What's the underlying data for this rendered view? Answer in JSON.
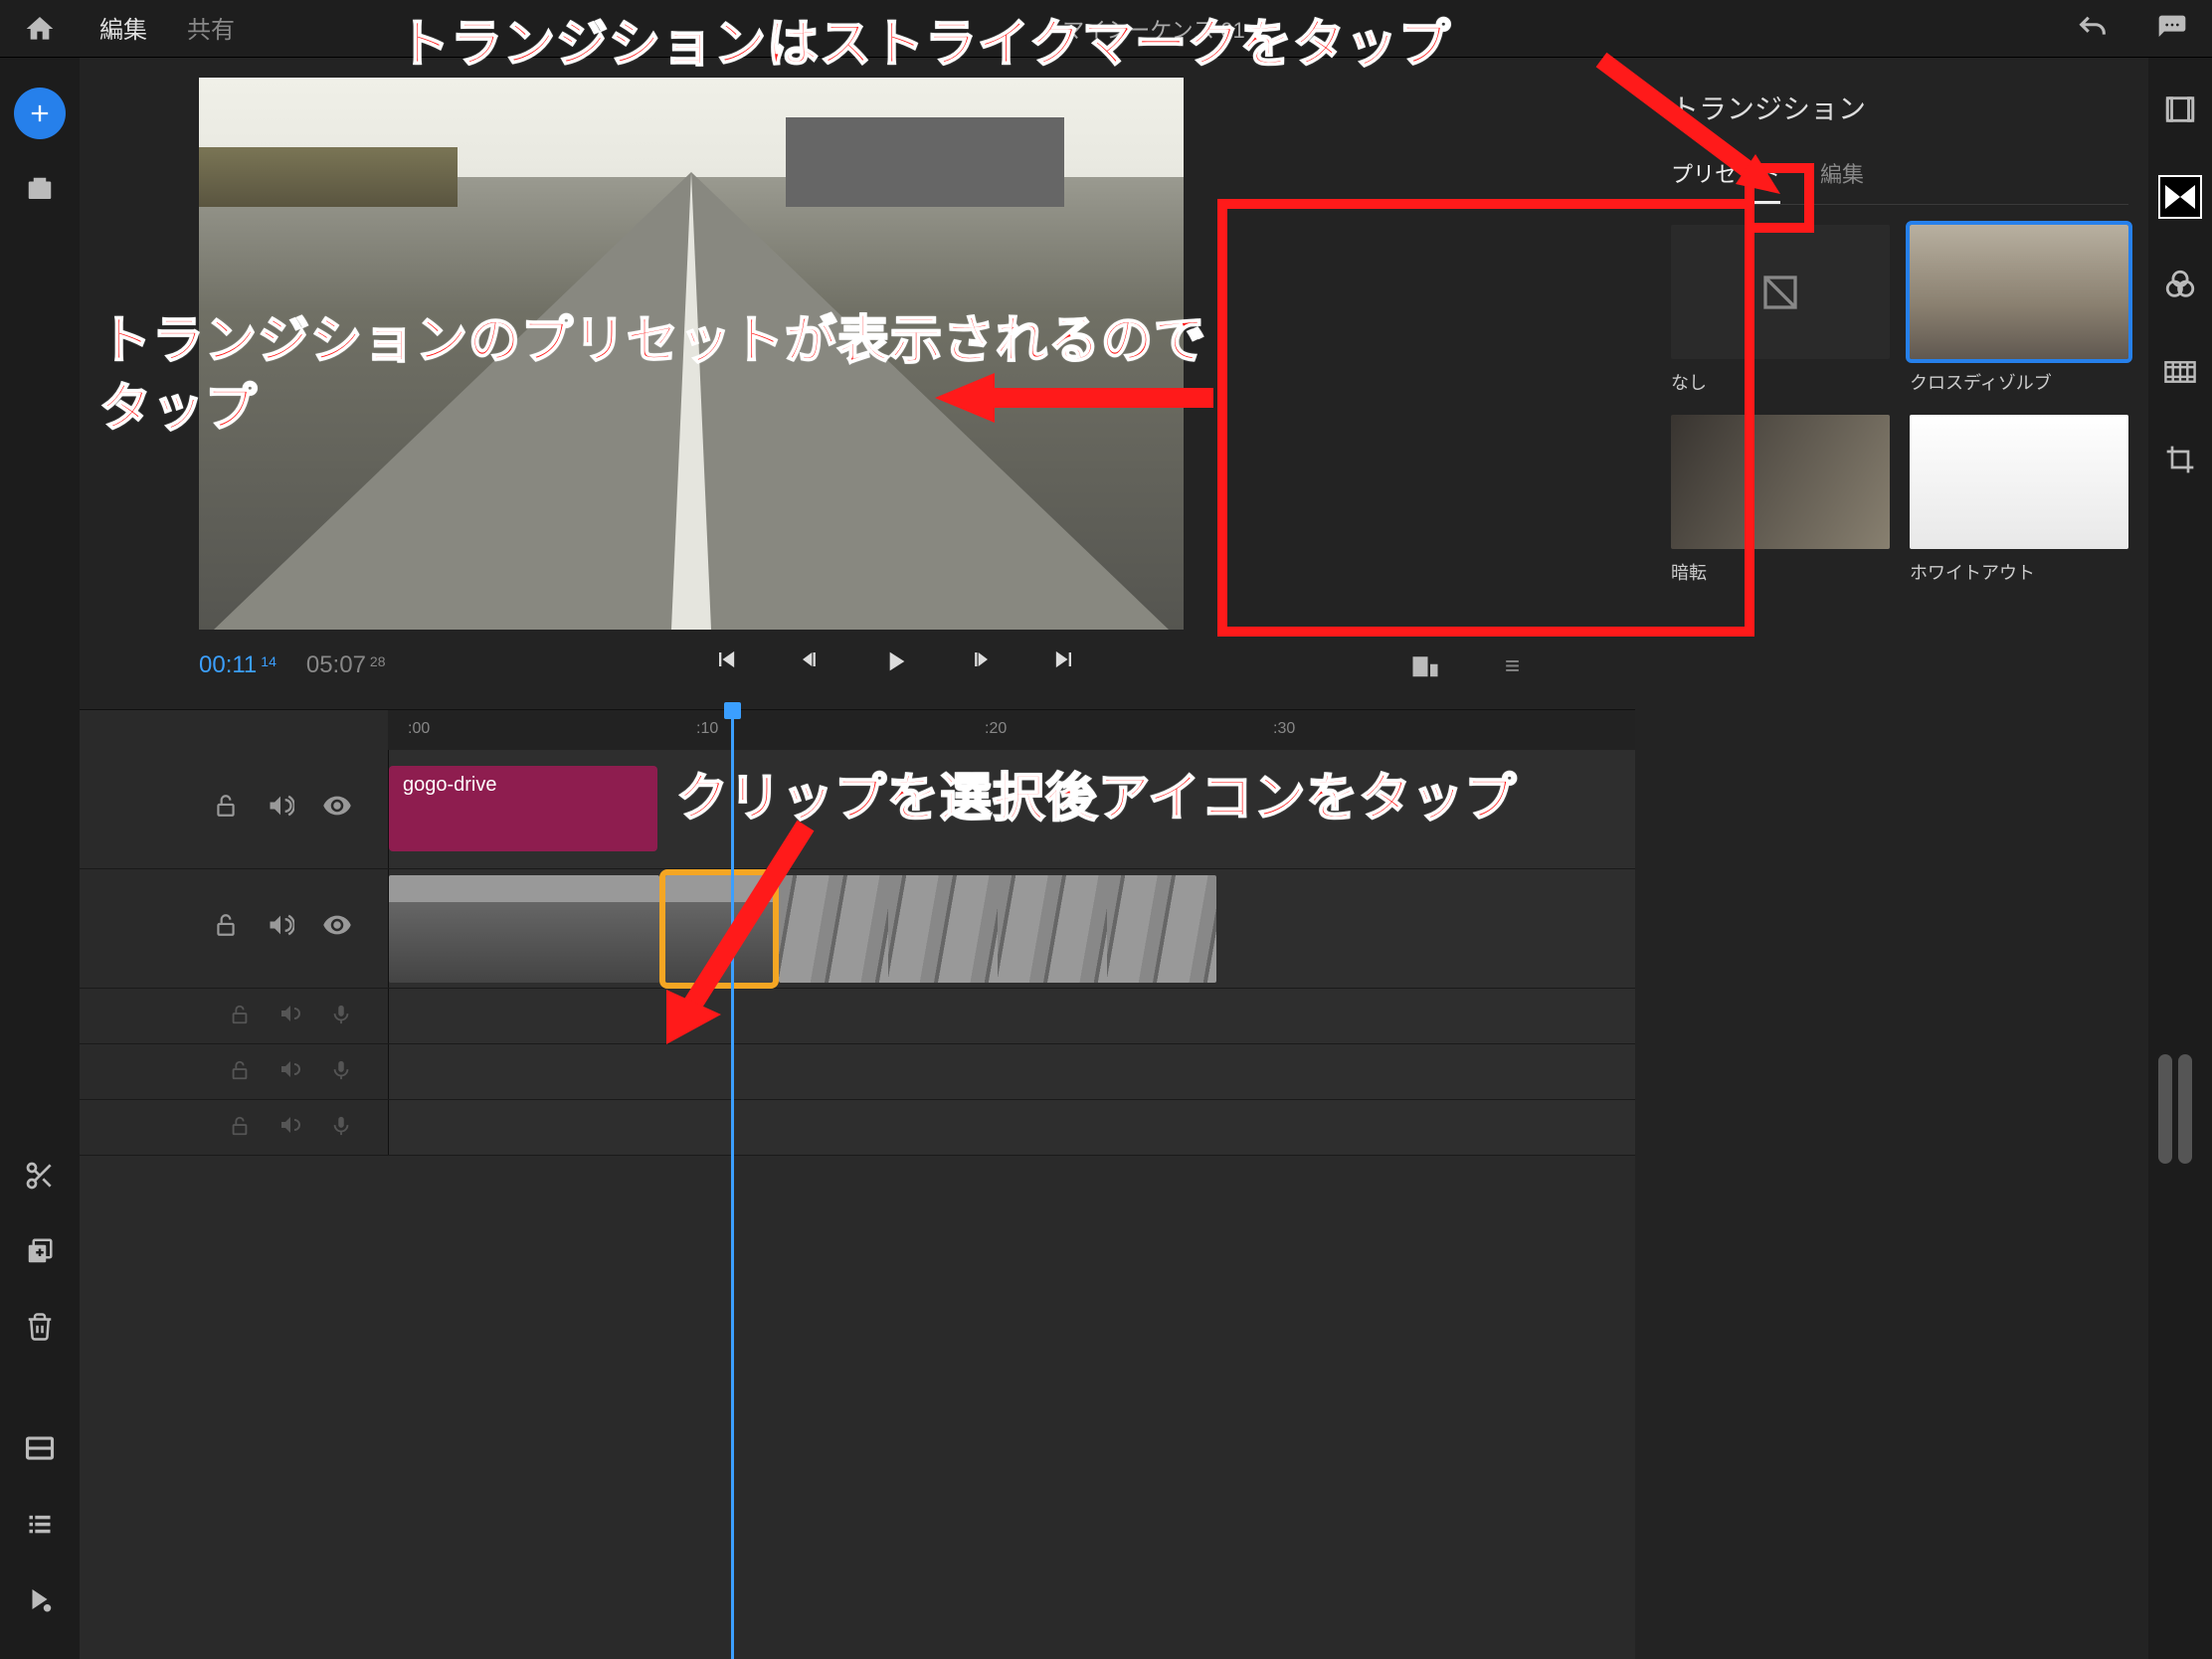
{
  "header": {
    "tab_edit": "編集",
    "tab_share": "共有",
    "project_title": "マイシーケンス 01"
  },
  "playback": {
    "current_time": "00:11",
    "current_frames": "14",
    "total_time": "05:07",
    "total_frames": "28"
  },
  "ruler": {
    "t0": ":00",
    "t10": ":10",
    "t20": ":20",
    "t30": ":30"
  },
  "tracks": {
    "title_clip_label": "gogo-drive"
  },
  "panel": {
    "title": "トランジション",
    "tab_preset": "プリセット",
    "tab_edit": "編集",
    "presets": {
      "none": "なし",
      "cross_dissolve": "クロスディゾルブ",
      "dip_black": "暗転",
      "dip_white": "ホワイトアウト"
    }
  },
  "annotations": {
    "top": "トランジションはストライクマークをタップ",
    "mid_line1": "トランジションのプリセットが表示されるので",
    "mid_line2": "タップ",
    "bottom": "クリップを選択後アイコンをタップ"
  }
}
